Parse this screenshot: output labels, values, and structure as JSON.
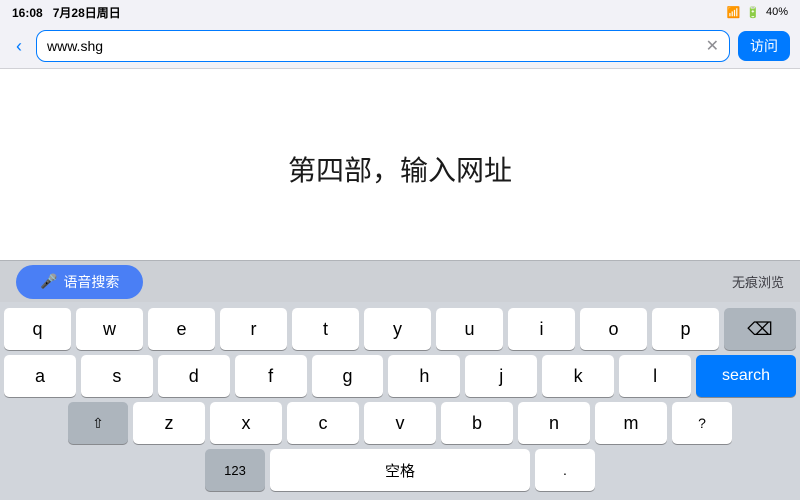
{
  "status_bar": {
    "time": "16:08",
    "date": "7月28日周日",
    "signal": "▼▲",
    "battery": "40%"
  },
  "browser_header": {
    "back_label": "‹",
    "url_value": "www.shg",
    "clear_icon": "✕",
    "visit_label": "访问"
  },
  "page_title_line1": "第四部，输入网址",
  "keyboard_toolbar": {
    "voice_search_label": "语音搜索",
    "mic_icon": "🎤",
    "incognito_label": "无痕浏览"
  },
  "keyboard": {
    "row1": [
      "q",
      "w",
      "e",
      "r",
      "t",
      "y",
      "u",
      "i",
      "o",
      "p"
    ],
    "row2": [
      "a",
      "s",
      "d",
      "f",
      "g",
      "h",
      "j",
      "k",
      "l"
    ],
    "row3_left": "⇧",
    "row3_middle": [
      "z",
      "x",
      "c",
      "v",
      "b",
      "n",
      "m"
    ],
    "row3_right": "⌫",
    "row4_left": "123",
    "row4_space": "空格",
    "row4_right": "?"
  },
  "search_button_label": "search"
}
